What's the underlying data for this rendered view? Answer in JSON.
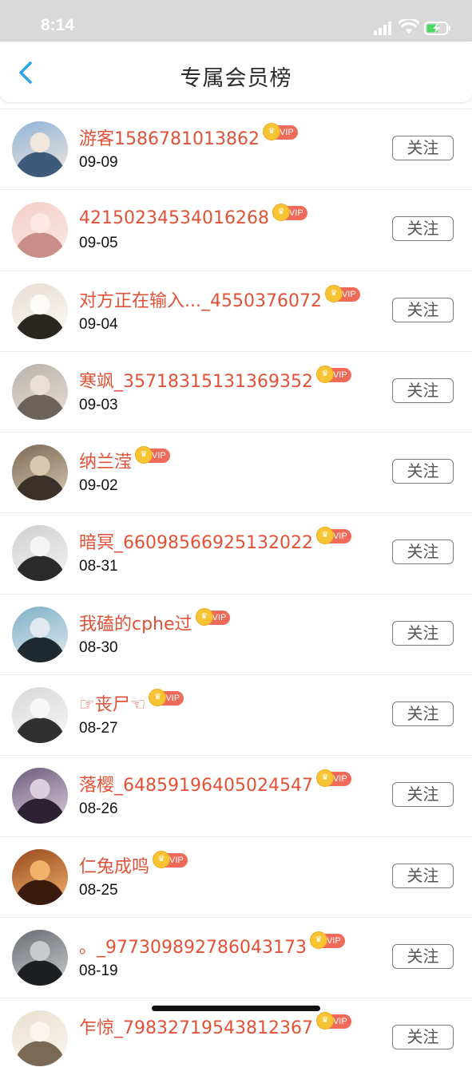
{
  "status_bar": {
    "time": "8:14"
  },
  "header": {
    "title": "专属会员榜",
    "back_icon": "chevron-left-icon"
  },
  "vip_badge_label": "VIP",
  "follow_label": "关注",
  "colors": {
    "name": "#e05238",
    "vip_badge": "#f06a5a",
    "coin": "#f8c433",
    "back_arrow": "#2aa3e8"
  },
  "members": [
    {
      "name": "游客1586781013862",
      "date": "09-09"
    },
    {
      "name": "42150234534016268",
      "date": "09-05"
    },
    {
      "name": "对方正在输入..._4550376072",
      "date": "09-04"
    },
    {
      "name": "寒飒_35718315131369352",
      "date": "09-03"
    },
    {
      "name": "纳兰滢",
      "date": "09-02"
    },
    {
      "name": "暗冥_66098566925132022",
      "date": "08-31"
    },
    {
      "name": "我磕的cphe过",
      "date": "08-30"
    },
    {
      "name": "☞丧尸☜",
      "date": "08-27"
    },
    {
      "name": "落樱_64859196405024547",
      "date": "08-26"
    },
    {
      "name": "仁兔成鸣",
      "date": "08-25"
    },
    {
      "name": "。_977309892786043173",
      "date": "08-19"
    },
    {
      "name": "乍惊_79832719543812367",
      "date": ""
    }
  ]
}
